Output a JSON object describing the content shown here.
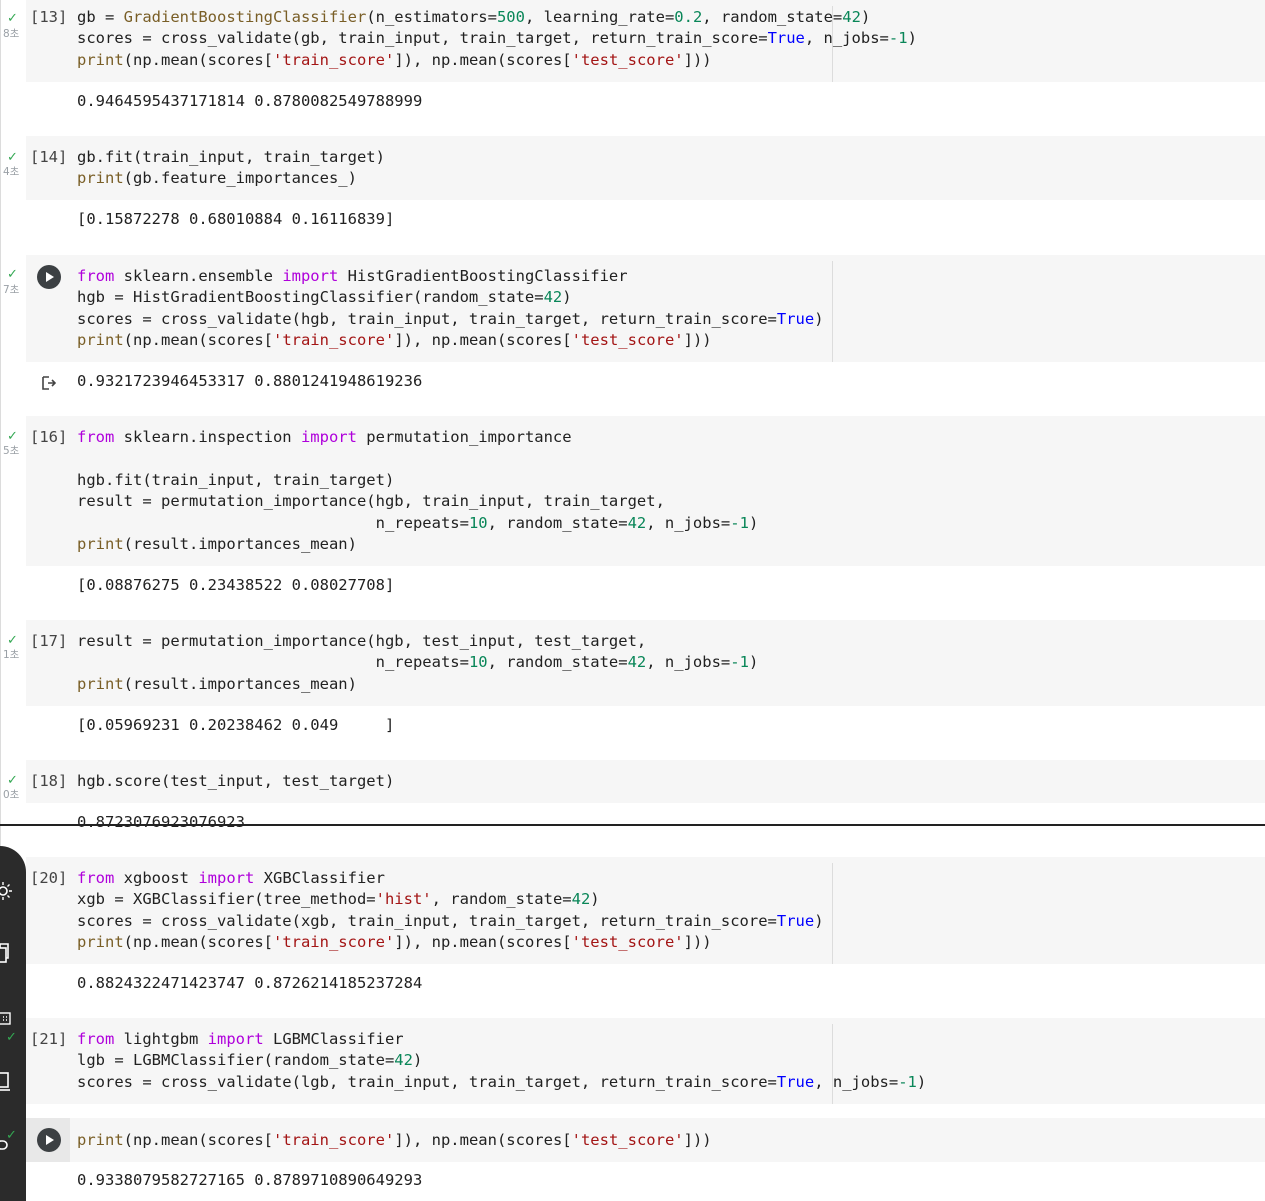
{
  "cells": [
    {
      "id": "c13",
      "exec_count": "[13]",
      "time": "8초",
      "status": "done",
      "code": [
        "gb = <span class=\"fn\">GradientBoostingClassifier</span>(n_estimators=<span class=\"n\">500</span>, learning_rate=<span class=\"n\">0.2</span>, random_state=<span class=\"n\">42</span>)",
        "scores = cross_validate(gb, train_input, train_target, return_train_score=<span class=\"bi\">True</span>, n_jobs=<span class=\"n\">-1</span>)",
        "<span class=\"fn\">print</span>(np.mean(scores[<span class=\"str\">'train_score'</span>]), np.mean(scores[<span class=\"str\">'test_score'</span>]))"
      ],
      "output": "0.9464595437171814 0.8780082549788999"
    },
    {
      "id": "c14",
      "exec_count": "[14]",
      "time": "4초",
      "status": "done",
      "code": [
        "gb.fit(train_input, train_target)",
        "<span class=\"fn\">print</span>(gb.feature_importances_)"
      ],
      "output": "[0.15872278 0.68010884 0.16116839]"
    },
    {
      "id": "c15",
      "exec_count": "",
      "time": "7초",
      "status": "run",
      "code": [
        "<span class=\"kw\">from</span> sklearn.ensemble <span class=\"kw\">import</span> HistGradientBoostingClassifier",
        "hgb = HistGradientBoostingClassifier(random_state=<span class=\"n\">42</span>)",
        "scores = cross_validate(hgb, train_input, train_target, return_train_score=<span class=\"bi\">True</span>)",
        "<span class=\"fn\">print</span>(np.mean(scores[<span class=\"str\">'train_score'</span>]), np.mean(scores[<span class=\"str\">'test_score'</span>]))"
      ],
      "output": "0.9321723946453317 0.8801241948619236"
    },
    {
      "id": "c16",
      "exec_count": "[16]",
      "time": "5초",
      "status": "done",
      "code": [
        "<span class=\"kw\">from</span> sklearn.inspection <span class=\"kw\">import</span> permutation_importance",
        "",
        "hgb.fit(train_input, train_target)",
        "result = permutation_importance(hgb, train_input, train_target,",
        "                                n_repeats=<span class=\"n\">10</span>, random_state=<span class=\"n\">42</span>, n_jobs=<span class=\"n\">-1</span>)",
        "<span class=\"fn\">print</span>(result.importances_mean)"
      ],
      "output": "[0.08876275 0.23438522 0.08027708]"
    },
    {
      "id": "c17",
      "exec_count": "[17]",
      "time": "1초",
      "status": "done",
      "code": [
        "result = permutation_importance(hgb, test_input, test_target,",
        "                                n_repeats=<span class=\"n\">10</span>, random_state=<span class=\"n\">42</span>, n_jobs=<span class=\"n\">-1</span>)",
        "<span class=\"fn\">print</span>(result.importances_mean)"
      ],
      "output": "[0.05969231 0.20238462 0.049     ]"
    },
    {
      "id": "c18",
      "exec_count": "[18]",
      "time": "0초",
      "status": "done",
      "code": [
        "hgb.score(test_input, test_target)"
      ],
      "output": "0.8723076923076923"
    },
    {
      "id": "c20",
      "exec_count": "[20]",
      "time": "",
      "status": "none",
      "code": [
        "<span class=\"kw\">from</span> xgboost <span class=\"kw\">import</span> XGBClassifier",
        "xgb = XGBClassifier(tree_method=<span class=\"str\">'hist'</span>, random_state=<span class=\"n\">42</span>)",
        "scores = cross_validate(xgb, train_input, train_target, return_train_score=<span class=\"bi\">True</span>)",
        "<span class=\"fn\">print</span>(np.mean(scores[<span class=\"str\">'train_score'</span>]), np.mean(scores[<span class=\"str\">'test_score'</span>]))"
      ],
      "output": "0.8824322471423747 0.8726214185237284"
    },
    {
      "id": "c21",
      "exec_count": "[21]",
      "time": "",
      "status": "none",
      "code": [
        "<span class=\"kw\">from</span> lightgbm <span class=\"kw\">import</span> LGBMClassifier",
        "lgb = LGBMClassifier(random_state=<span class=\"n\">42</span>)",
        "scores = cross_validate(lgb, train_input, train_target, return_train_score=<span class=\"bi\">True</span>, n_jobs=<span class=\"n\">-1</span>)"
      ],
      "output": ""
    },
    {
      "id": "c22",
      "exec_count": "",
      "time": "",
      "status": "run",
      "code": [
        "<span class=\"fn\">print</span>(np.mean(scores[<span class=\"str\">'train_score'</span>]), np.mean(scores[<span class=\"str\">'test_score'</span>]))"
      ],
      "output": "0.9338079582727165 0.8789710890649293"
    }
  ]
}
